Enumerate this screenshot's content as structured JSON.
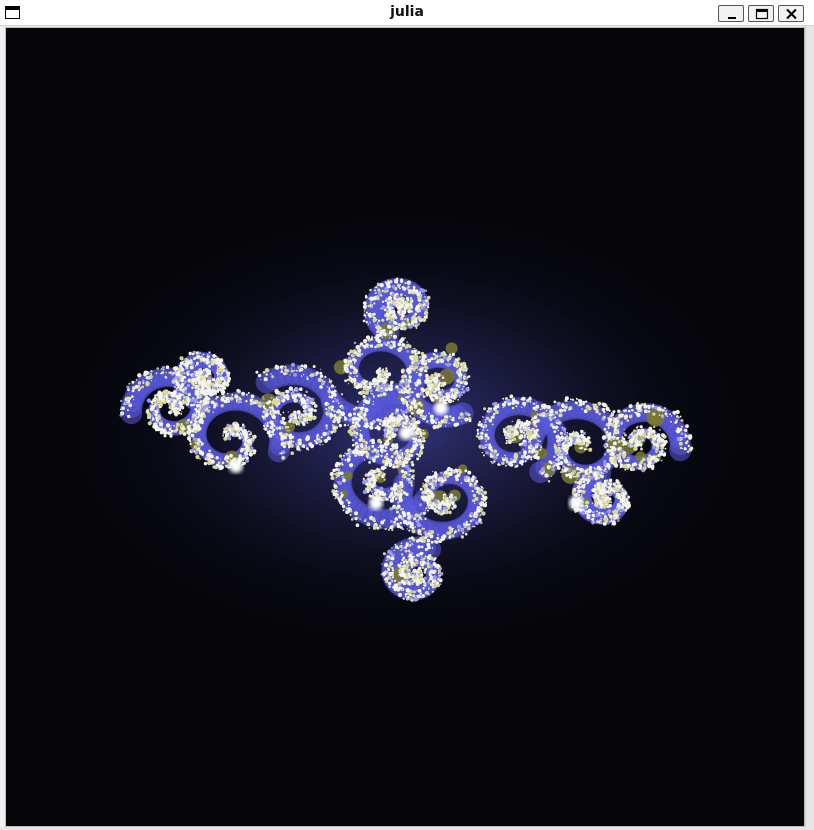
{
  "window": {
    "title": "julia",
    "controls": {
      "minimize": "minimize-icon",
      "maximize": "maximize-icon",
      "close": "close-icon"
    }
  },
  "canvas": {
    "content": "julia-set-fractal",
    "colors": {
      "background": "#05050a",
      "glow": "#3a3a9a",
      "fill_blue": "#5a5adc",
      "fill_olive": "#7a7a30",
      "speckle": "#f4f4e8"
    }
  }
}
